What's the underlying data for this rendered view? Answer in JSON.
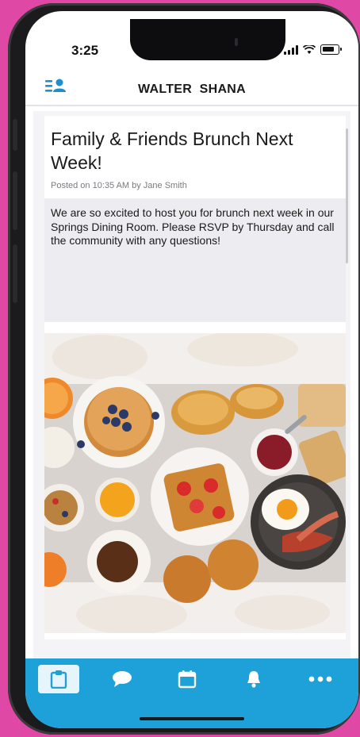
{
  "status": {
    "time": "3:25"
  },
  "header": {
    "title": "WALTER  SHANA",
    "icon": "profile-list-icon"
  },
  "post": {
    "title": "Family & Friends Brunch Next Week!",
    "meta": "Posted on 10:35 AM by Jane Smith",
    "body": "We are so excited to host you for brunch next week in our Springs Dining Room. Please RSVP by Thursday and call the community with any questions!"
  },
  "tabbar": {
    "tabs": [
      {
        "name": "posts",
        "icon": "clipboard-icon",
        "active": true
      },
      {
        "name": "messages",
        "icon": "chat-bubble-icon",
        "active": false
      },
      {
        "name": "calendar",
        "icon": "calendar-icon",
        "active": false
      },
      {
        "name": "notifications",
        "icon": "bell-icon",
        "active": false
      },
      {
        "name": "more",
        "icon": "more-dots-icon",
        "active": false
      }
    ]
  },
  "colors": {
    "accent": "#1da1d8",
    "background": "#e048a6"
  }
}
